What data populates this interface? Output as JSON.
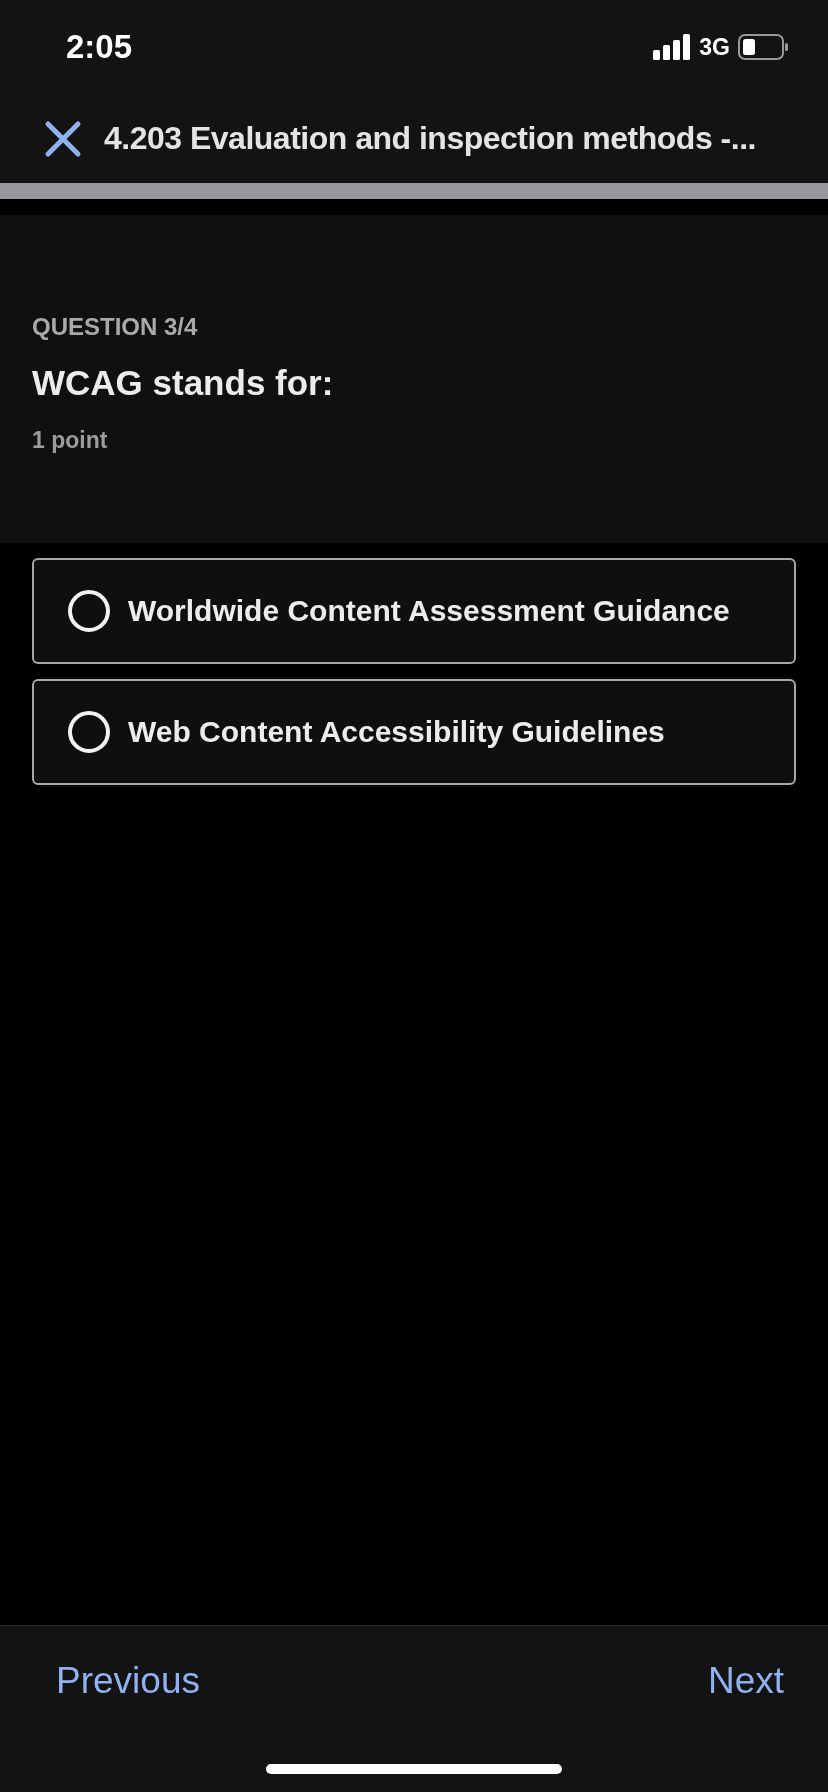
{
  "status_bar": {
    "time": "2:05",
    "network": "3G"
  },
  "header": {
    "title": "4.203 Evaluation and inspection methods -..."
  },
  "question": {
    "counter": "QUESTION 3/4",
    "text": "WCAG stands for:",
    "points": "1 point"
  },
  "options": [
    {
      "label": "Worldwide Content Assessment Guidance",
      "selected": false
    },
    {
      "label": "Web Content Accessibility Guidelines",
      "selected": false
    }
  ],
  "footer": {
    "previous": "Previous",
    "next": "Next"
  }
}
